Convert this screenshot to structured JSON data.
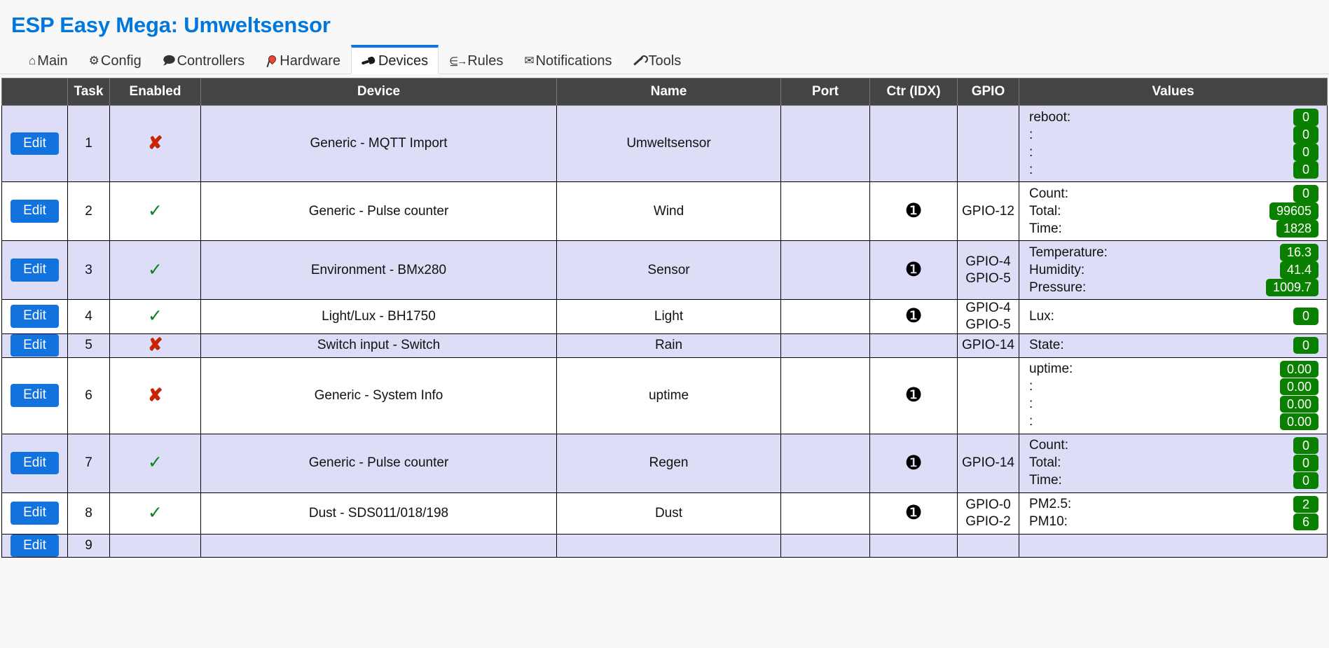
{
  "header": {
    "title": "ESP Easy Mega: Umweltsensor"
  },
  "tabs": [
    {
      "label": "Main",
      "icon": "home-icon",
      "active": false
    },
    {
      "label": "Config",
      "icon": "gear-icon",
      "active": false
    },
    {
      "label": "Controllers",
      "icon": "chat-icon",
      "active": false
    },
    {
      "label": "Hardware",
      "icon": "pin-icon",
      "active": false
    },
    {
      "label": "Devices",
      "icon": "plug-icon",
      "active": true
    },
    {
      "label": "Rules",
      "icon": "rules-icon",
      "active": false
    },
    {
      "label": "Notifications",
      "icon": "mail-icon",
      "active": false
    },
    {
      "label": "Tools",
      "icon": "wrench-icon",
      "active": false
    }
  ],
  "table": {
    "columns": [
      "",
      "Task",
      "Enabled",
      "Device",
      "Name",
      "Port",
      "Ctr (IDX)",
      "GPIO",
      "Values"
    ],
    "edit_label": "Edit",
    "enabled_yes": "✓",
    "enabled_no": "✘",
    "ctr_badge": "❶",
    "rows": [
      {
        "task": "1",
        "enabled": false,
        "device": "Generic - MQTT Import",
        "name": "Umweltsensor",
        "port": "",
        "ctr": "",
        "gpio": "",
        "values": [
          {
            "label": "reboot:",
            "value": "0"
          },
          {
            "label": ":",
            "value": "0"
          },
          {
            "label": ":",
            "value": "0"
          },
          {
            "label": ":",
            "value": "0"
          }
        ]
      },
      {
        "task": "2",
        "enabled": true,
        "device": "Generic - Pulse counter",
        "name": "Wind",
        "port": "",
        "ctr": "1",
        "gpio": "GPIO-12",
        "values": [
          {
            "label": "Count:",
            "value": "0"
          },
          {
            "label": "Total:",
            "value": "99605"
          },
          {
            "label": "Time:",
            "value": "1828"
          }
        ]
      },
      {
        "task": "3",
        "enabled": true,
        "device": "Environment - BMx280",
        "name": "Sensor",
        "port": "",
        "ctr": "1",
        "gpio": "GPIO-4\nGPIO-5",
        "values": [
          {
            "label": "Temperature:",
            "value": "16.3"
          },
          {
            "label": "Humidity:",
            "value": "41.4"
          },
          {
            "label": "Pressure:",
            "value": "1009.7"
          }
        ]
      },
      {
        "task": "4",
        "enabled": true,
        "device": "Light/Lux - BH1750",
        "name": "Light",
        "port": "",
        "ctr": "1",
        "gpio": "GPIO-4\nGPIO-5",
        "values": [
          {
            "label": "Lux:",
            "value": "0"
          }
        ]
      },
      {
        "task": "5",
        "enabled": false,
        "device": "Switch input - Switch",
        "name": "Rain",
        "port": "",
        "ctr": "",
        "gpio": "GPIO-14",
        "values": [
          {
            "label": "State:",
            "value": "0"
          }
        ]
      },
      {
        "task": "6",
        "enabled": false,
        "device": "Generic - System Info",
        "name": "uptime",
        "port": "",
        "ctr": "1",
        "gpio": "",
        "values": [
          {
            "label": "uptime:",
            "value": "0.00"
          },
          {
            "label": ":",
            "value": "0.00"
          },
          {
            "label": ":",
            "value": "0.00"
          },
          {
            "label": ":",
            "value": "0.00"
          }
        ]
      },
      {
        "task": "7",
        "enabled": true,
        "device": "Generic - Pulse counter",
        "name": "Regen",
        "port": "",
        "ctr": "1",
        "gpio": "GPIO-14",
        "values": [
          {
            "label": "Count:",
            "value": "0"
          },
          {
            "label": "Total:",
            "value": "0"
          },
          {
            "label": "Time:",
            "value": "0"
          }
        ]
      },
      {
        "task": "8",
        "enabled": true,
        "device": "Dust - SDS011/018/198",
        "name": "Dust",
        "port": "",
        "ctr": "1",
        "gpio": "GPIO-0\nGPIO-2",
        "values": [
          {
            "label": "PM2.5:",
            "value": "2"
          },
          {
            "label": "PM10:",
            "value": "6"
          }
        ]
      },
      {
        "task": "9",
        "enabled": null,
        "device": "",
        "name": "",
        "port": "",
        "ctr": "",
        "gpio": "",
        "values": []
      }
    ]
  },
  "colors": {
    "title": "#0077DD",
    "accent": "#1273DE",
    "header_bg": "#444444",
    "row_alt_bg": "#DDDDF8",
    "badge_green": "#0A8000",
    "mark_no": "#CC2200",
    "mark_yes": "#108020"
  }
}
